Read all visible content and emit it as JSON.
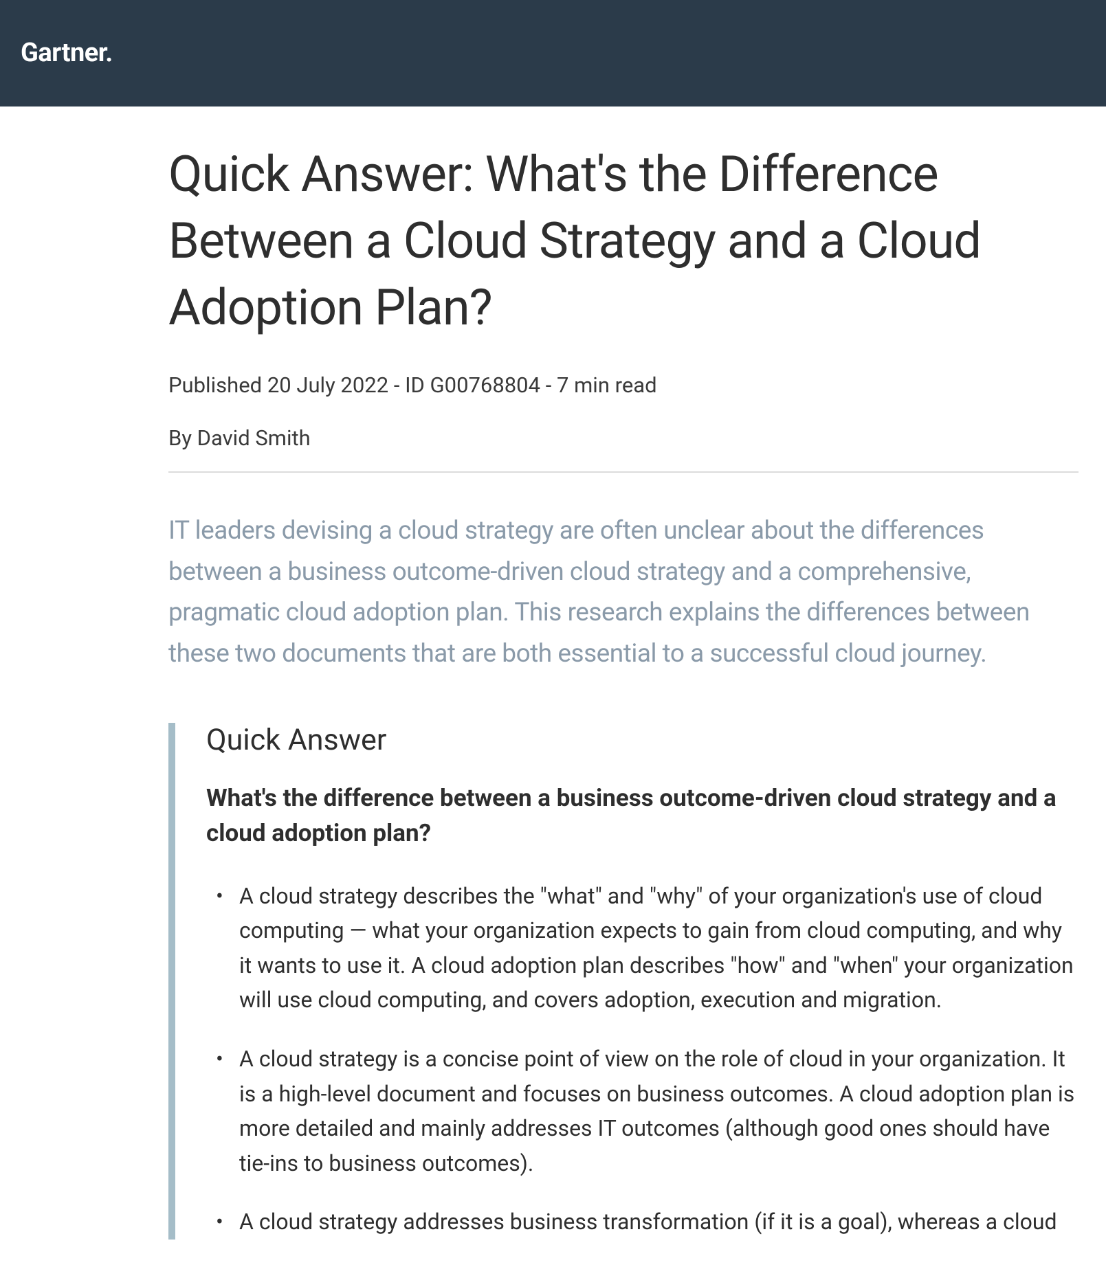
{
  "header": {
    "logo": "Gartner."
  },
  "article": {
    "title": "Quick Answer: What's the Difference Between a Cloud Strategy and a Cloud Adoption Plan?",
    "meta": "Published 20 July 2022 - ID G00768804 - 7 min read",
    "byline": "By David Smith",
    "summary": "IT leaders devising a cloud strategy are often unclear about the differences between a business outcome-driven cloud strategy and a comprehensive, pragmatic cloud adoption plan. This research explains the differences between these two documents that are both essential to a successful cloud journey.",
    "qa": {
      "heading": "Quick Answer",
      "subheading": "What's the difference between a business outcome-driven cloud strategy and a cloud adoption plan?",
      "bullets": [
        "A cloud strategy describes the \"what\" and \"why\" of your organization's use of cloud computing — what your organization expects to gain from cloud computing, and why it wants to use it. A cloud adoption plan describes \"how\" and \"when\" your organization will use cloud computing, and covers adoption, execution and migration.",
        "A cloud strategy is a concise point of view on the role of cloud in your organization. It is a high-level document and focuses on business outcomes. A cloud adoption plan is more detailed and mainly addresses IT outcomes (although good ones should have tie-ins to business outcomes).",
        "A cloud strategy addresses business transformation (if it is a goal), whereas a cloud"
      ]
    }
  }
}
